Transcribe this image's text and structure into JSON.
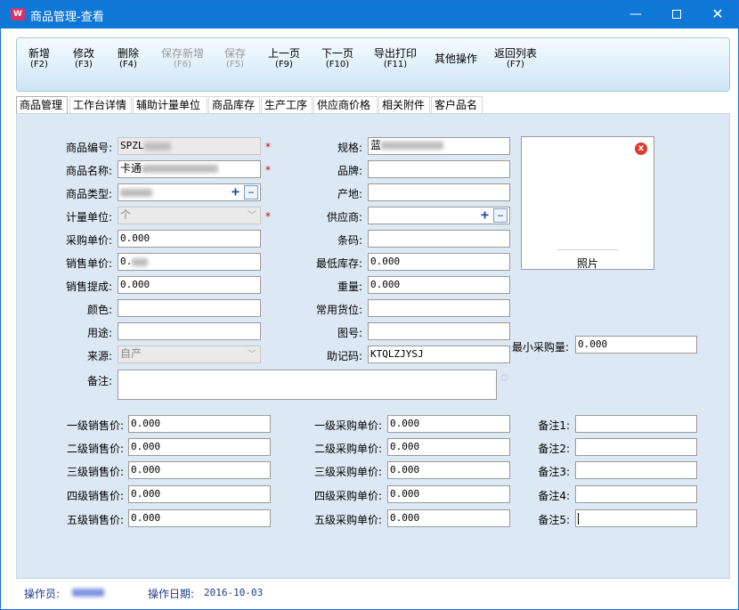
{
  "window": {
    "title": "商品管理-查看",
    "min": "—",
    "close": "✕"
  },
  "toolbar": [
    {
      "label": "新增",
      "key": "(F2)",
      "disabled": false
    },
    {
      "label": "修改",
      "key": "(F3)",
      "disabled": false
    },
    {
      "label": "删除",
      "key": "(F4)",
      "disabled": false
    },
    {
      "label": "保存新增",
      "key": "(F6)",
      "disabled": true
    },
    {
      "label": "保存",
      "key": "(F5)",
      "disabled": true
    },
    {
      "label": "上一页",
      "key": "(F9)",
      "disabled": false
    },
    {
      "label": "下一页",
      "key": "(F10)",
      "disabled": false
    },
    {
      "label": "导出打印",
      "key": "(F11)",
      "disabled": false
    },
    {
      "label": "其他操作",
      "key": "",
      "disabled": false
    },
    {
      "label": "返回列表",
      "key": "(F7)",
      "disabled": false
    }
  ],
  "tabs": [
    "商品管理",
    "工作台详情",
    "辅助计量单位",
    "商品库存",
    "生产工序",
    "供应商价格",
    "相关附件",
    "客户品名"
  ],
  "form": {
    "product_code_label": "商品编号:",
    "product_code": "SPZL",
    "product_name_label": "商品名称:",
    "product_name": "卡通",
    "product_type_label": "商品类型:",
    "unit_label": "计量单位:",
    "unit": "个",
    "purchase_price_label": "采购单价:",
    "purchase_price": "0.000",
    "sale_price_label": "销售单价:",
    "sale_price": "0.",
    "commission_label": "销售提成:",
    "commission": "0.000",
    "color_label": "颜色:",
    "usage_label": "用途:",
    "source_label": "来源:",
    "source": "自产",
    "remark_label": "备注:",
    "spec_label": "规格:",
    "spec": "蓝",
    "brand_label": "品牌:",
    "origin_label": "产地:",
    "supplier_label": "供应商:",
    "barcode_label": "条码:",
    "min_stock_label": "最低库存:",
    "min_stock": "0.000",
    "weight_label": "重量:",
    "weight": "0.000",
    "location_label": "常用货位:",
    "drawing_label": "图号:",
    "mnemonic_label": "助记码:",
    "mnemonic": "KTQLZJYSJ",
    "min_purchase_label": "最小采购量:",
    "min_purchase": "0.000",
    "photo_label": "照片",
    "required_mark": "*",
    "plus": "+",
    "more": "…",
    "photo_close": "x",
    "caret": "﹀",
    "scroll_up": "︿"
  },
  "price_levels": [
    {
      "sale_label": "一级销售价:",
      "sale": "0.000",
      "buy_label": "一级采购单价:",
      "buy": "0.000",
      "note_label": "备注1:",
      "note": ""
    },
    {
      "sale_label": "二级销售价:",
      "sale": "0.000",
      "buy_label": "二级采购单价:",
      "buy": "0.000",
      "note_label": "备注2:",
      "note": ""
    },
    {
      "sale_label": "三级销售价:",
      "sale": "0.000",
      "buy_label": "三级采购单价:",
      "buy": "0.000",
      "note_label": "备注3:",
      "note": ""
    },
    {
      "sale_label": "四级销售价:",
      "sale": "0.000",
      "buy_label": "四级采购单价:",
      "buy": "0.000",
      "note_label": "备注4:",
      "note": ""
    },
    {
      "sale_label": "五级销售价:",
      "sale": "0.000",
      "buy_label": "五级采购单价:",
      "buy": "0.000",
      "note_label": "备注5:",
      "note": ""
    }
  ],
  "status": {
    "operator_label": "操作员:",
    "date_label": "操作日期:",
    "date": "2016-10-03"
  },
  "colors": {
    "titlebar": "#0f78d7",
    "panel": "#dce9f4",
    "required": "#e00000",
    "status_label": "#1f3c8a"
  }
}
